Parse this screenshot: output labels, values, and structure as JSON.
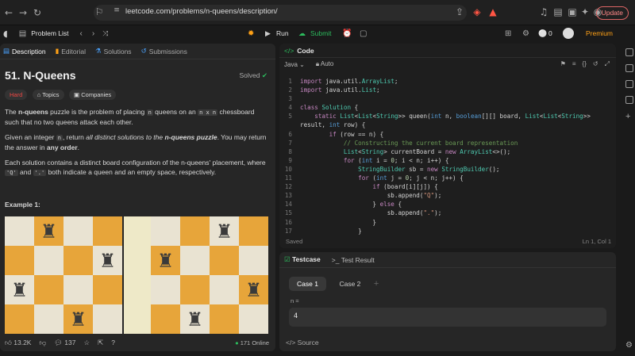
{
  "browser": {
    "url": "leetcode.com/problems/n-queens/description/",
    "update_label": "Update"
  },
  "app": {
    "problem_list": "Problem List",
    "run": "Run",
    "submit": "Submit",
    "coins": "0",
    "premium": "Premium"
  },
  "left_tabs": [
    "Description",
    "Editorial",
    "Solutions",
    "Submissions"
  ],
  "problem": {
    "title": "51. N-Queens",
    "status": "Solved",
    "difficulty": "Hard",
    "topics": "Topics",
    "companies": "Companies",
    "p1_a": "The ",
    "p1_b": "n-queens",
    "p1_c": " puzzle is the problem of placing ",
    "p1_code1": "n",
    "p1_d": " queens on an ",
    "p1_code2": "n x n",
    "p1_e": " chessboard such that no two queens attack each other.",
    "p2_a": "Given an integer ",
    "p2_code": "n",
    "p2_b": ", return ",
    "p2_c": "all distinct solutions to the ",
    "p2_d": "n-queens puzzle",
    "p2_e": ". You may return the answer in ",
    "p2_f": "any order",
    "p2_g": ".",
    "p3_a": "Each solution contains a distinct board configuration of the n-queens' placement, where ",
    "p3_code1": "'Q'",
    "p3_b": " and ",
    "p3_code2": "'.'",
    "p3_c": " both indicate a queen and an empty space, respectively.",
    "example": "Example 1:"
  },
  "footer": {
    "likes": "13.2K",
    "comments": "137",
    "online": "171 Online"
  },
  "code_panel": {
    "title": "Code",
    "language": "Java",
    "mode": "Auto",
    "saved": "Saved",
    "cursor": "Ln 1, Col 1",
    "lines": [
      {
        "n": "1",
        "t": "import java.util.ArrayList;"
      },
      {
        "n": "2",
        "t": "import java.util.List;"
      },
      {
        "n": "3",
        "t": ""
      },
      {
        "n": "4",
        "t": "class Solution {"
      },
      {
        "n": "5",
        "t": "    static List<List<String>> queen(int n, boolean[][] board, List<List<String>>"
      },
      {
        "n": "",
        "t": "result, int row) {"
      },
      {
        "n": "6",
        "t": "        if (row == n) {"
      },
      {
        "n": "7",
        "t": "            // Constructing the current board representation"
      },
      {
        "n": "8",
        "t": "            List<String> currentBoard = new ArrayList<>();"
      },
      {
        "n": "9",
        "t": "            for (int i = 0; i < n; i++) {"
      },
      {
        "n": "10",
        "t": "                StringBuilder sb = new StringBuilder();"
      },
      {
        "n": "11",
        "t": "                for (int j = 0; j < n; j++) {"
      },
      {
        "n": "12",
        "t": "                    if (board[i][j]) {"
      },
      {
        "n": "13",
        "t": "                        sb.append(\"Q\");"
      },
      {
        "n": "14",
        "t": "                    } else {"
      },
      {
        "n": "15",
        "t": "                        sb.append(\".\");"
      },
      {
        "n": "16",
        "t": "                    }"
      },
      {
        "n": "17",
        "t": "                }"
      }
    ]
  },
  "testcase": {
    "tab1": "Testcase",
    "tab2": "Test Result",
    "case1": "Case 1",
    "case2": "Case 2",
    "label": "n =",
    "value": "4",
    "source": "Source"
  },
  "boards": [
    [
      ".Q..",
      "...Q",
      "Q...",
      "..Q."
    ],
    [
      "..Q.",
      "Q...",
      "...Q",
      ".Q.."
    ]
  ],
  "colors": {
    "accent": "#ffa116",
    "green": "#2cbb5d",
    "hard": "#ef4743"
  }
}
